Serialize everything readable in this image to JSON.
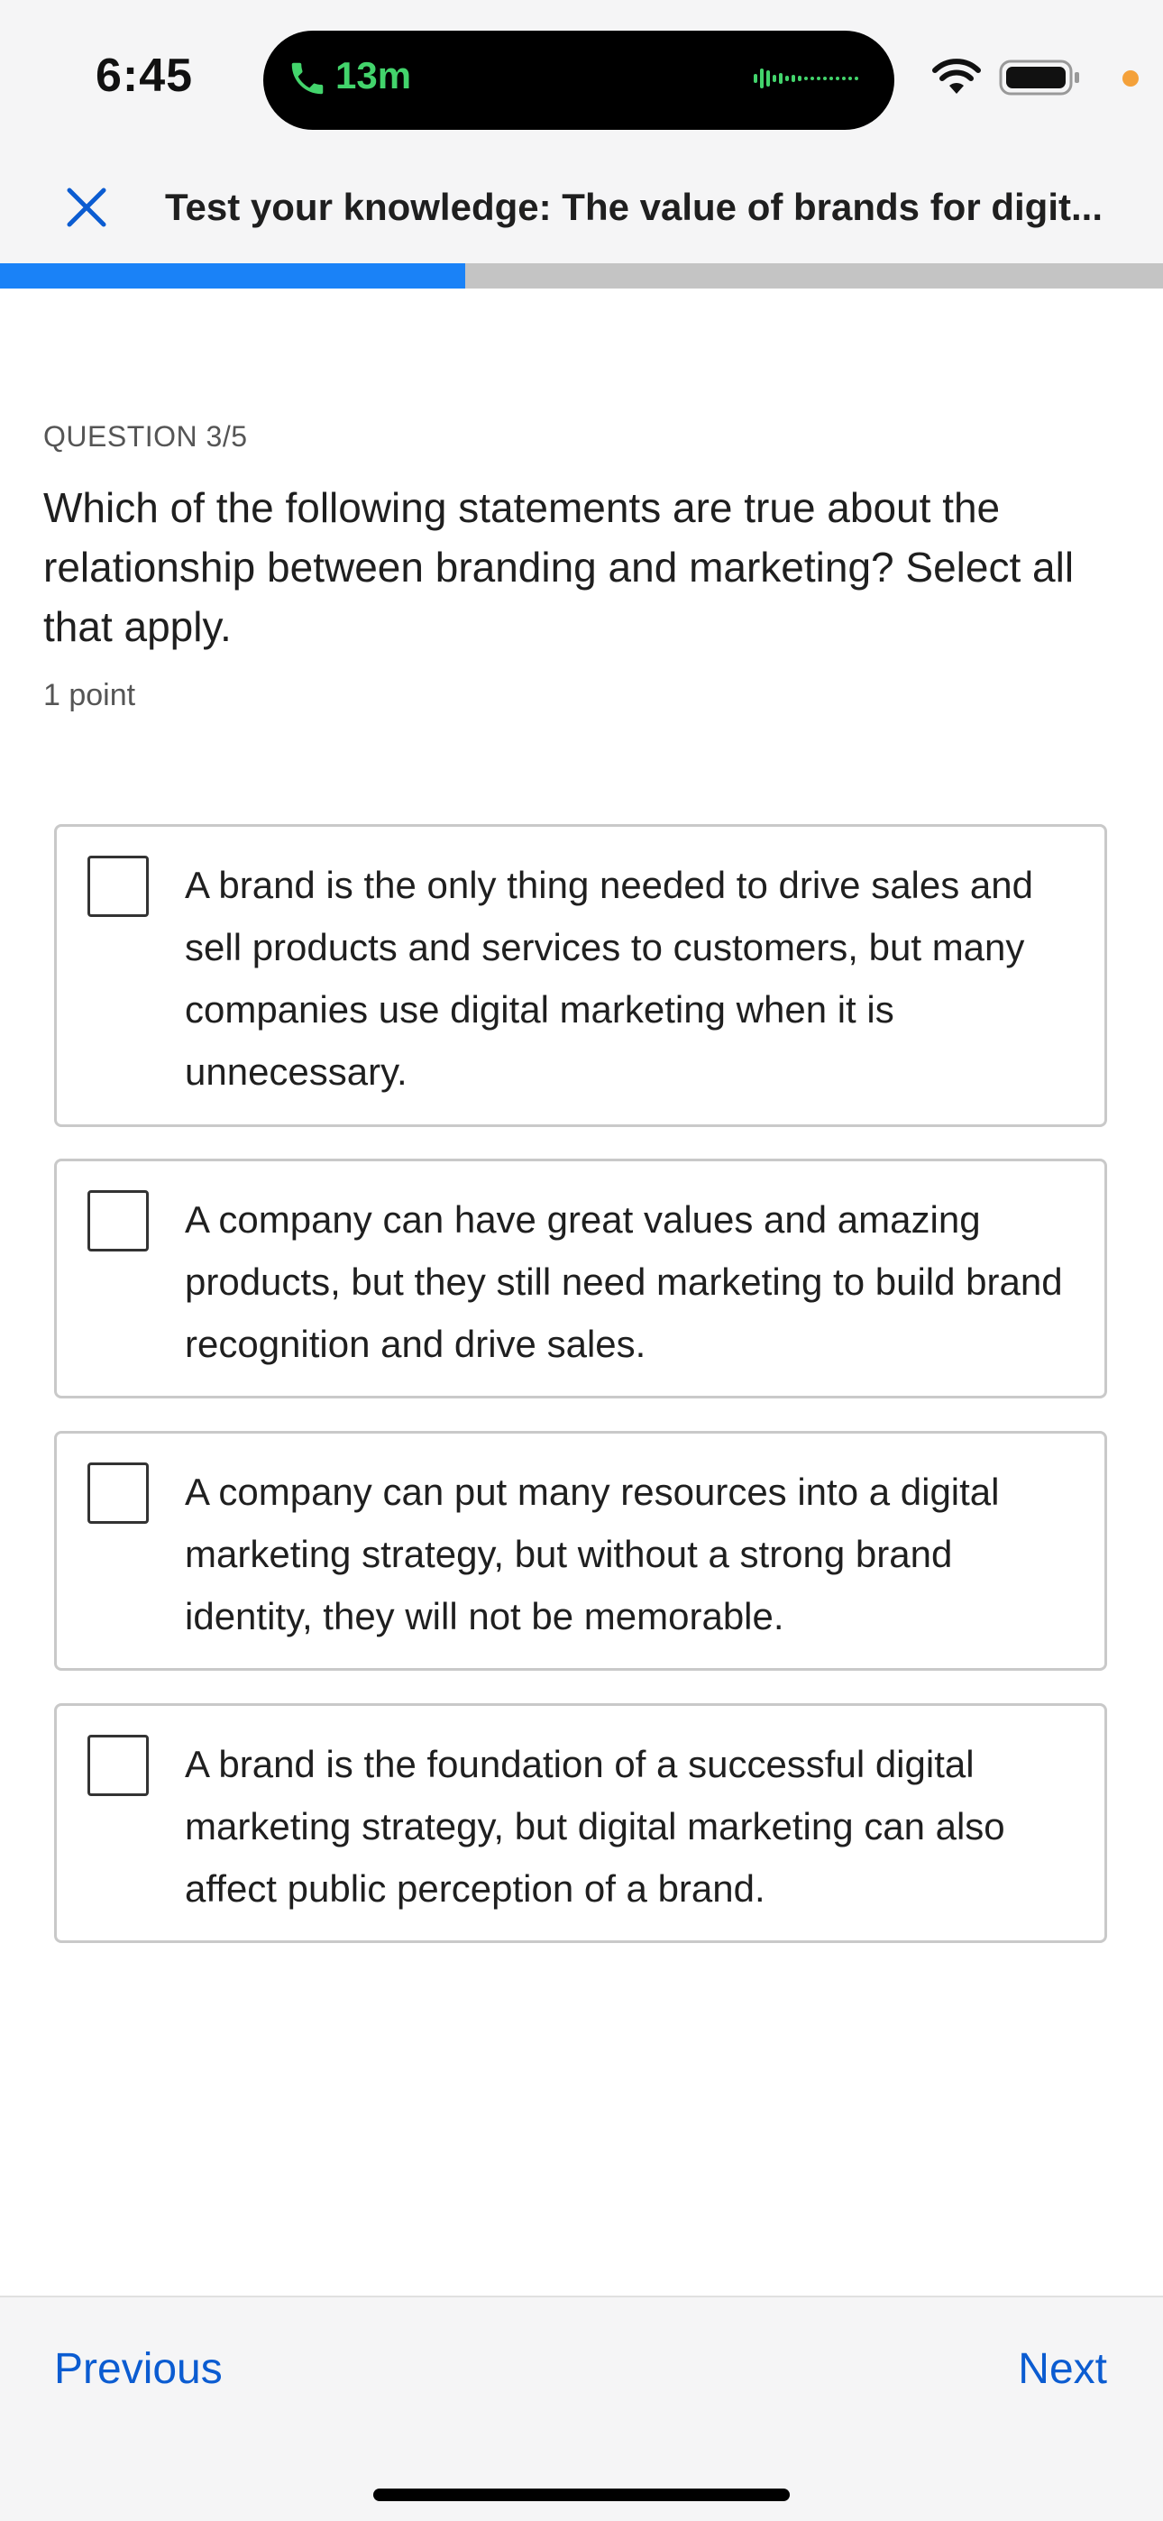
{
  "status_bar": {
    "time": "6:45",
    "call_duration": "13m",
    "call_color": "#43d46c",
    "mic_indicator_color": "#f4a13a"
  },
  "header": {
    "close_icon": "close-icon",
    "title": "Test your knowledge: The value of brands for digit..."
  },
  "progress": {
    "fraction": 0.4,
    "fill_color": "#1a82f7",
    "track_color": "#c4c4c4"
  },
  "question": {
    "number_label": "QUESTION 3/5",
    "text": "Which of the following statements are true about the relationship between branding and marketing? Select all that apply.",
    "points": "1 point"
  },
  "options": [
    {
      "text": "A brand is the only thing needed to drive sales and sell products and services to customers, but many companies use digital marketing when it is unnecessary.",
      "checked": false
    },
    {
      "text": "A company can have great values and amazing products, but they still need marketing to build brand recognition and drive sales.",
      "checked": false
    },
    {
      "text": "A company can put many resources into a digital marketing strategy, but without a strong brand identity, they will not be memorable.",
      "checked": false
    },
    {
      "text": "A brand is the foundation of a successful digital marketing strategy, but digital marketing can also affect public perception of a brand.",
      "checked": false
    }
  ],
  "footer": {
    "previous_label": "Previous",
    "next_label": "Next",
    "link_color": "#0b5cd1"
  }
}
